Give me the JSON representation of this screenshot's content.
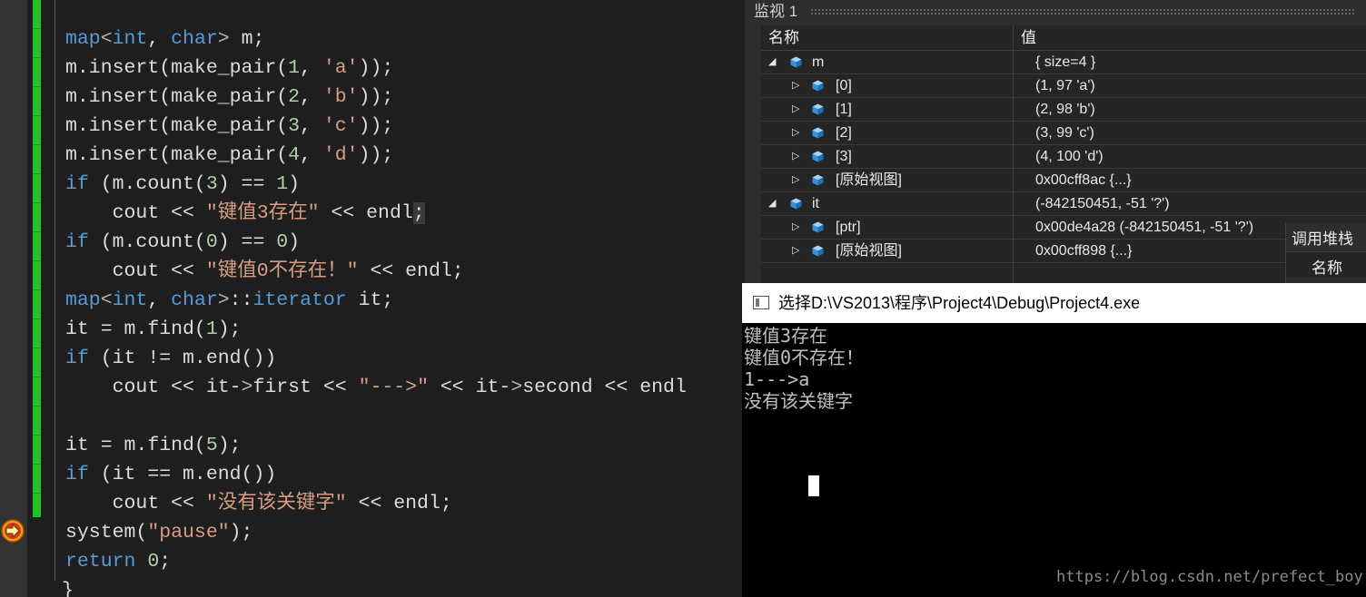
{
  "editor": {
    "lines": [
      "map<int, char> m;",
      "m.insert(make_pair(1, 'a'));",
      "m.insert(make_pair(2, 'b'));",
      "m.insert(make_pair(3, 'c'));",
      "m.insert(make_pair(4, 'd'));",
      "if (m.count(3) == 1)",
      "    cout << \"键值3存在\" << endl;",
      "if (m.count(0) == 0)",
      "    cout << \"键值0不存在！\" << endl;",
      "map<int, char>::iterator it;",
      "it = m.find(1);",
      "if (it != m.end())",
      "    cout << it->first << \"--->\" << it->second << endl",
      "",
      "it = m.find(5);",
      "if (it == m.end())",
      "    cout << \"没有该关键字\" << endl;",
      "system(\"pause\");",
      "return 0;",
      "}"
    ]
  },
  "watch": {
    "title": "监视 1",
    "col_name": "名称",
    "col_value": "值",
    "rows": [
      {
        "name": "m",
        "value": "{ size=4 }",
        "expanded": true
      },
      {
        "name": "[0]",
        "value": "(1, 97 'a')",
        "expanded": false
      },
      {
        "name": "[1]",
        "value": "(2, 98 'b')",
        "expanded": false
      },
      {
        "name": "[2]",
        "value": "(3, 99 'c')",
        "expanded": false
      },
      {
        "name": "[3]",
        "value": "(4, 100 'd')",
        "expanded": false
      },
      {
        "name": "[原始视图]",
        "value": "0x00cff8ac {...}",
        "expanded": false
      },
      {
        "name": "it",
        "value": "(-842150451, -51 '?')",
        "expanded": true
      },
      {
        "name": "[ptr]",
        "value": "0x00de4a28 (-842150451, -51 '?')",
        "expanded": false
      },
      {
        "name": "[原始视图]",
        "value": "0x00cff898 {...}",
        "expanded": false
      }
    ]
  },
  "callstack": {
    "title": "调用堆栈",
    "col_name": "名称"
  },
  "console": {
    "title": "选择D:\\VS2013\\程序\\Project4\\Debug\\Project4.exe",
    "output": [
      "键值3存在",
      "键值0不存在！",
      "1--->a",
      "没有该关键字"
    ]
  },
  "watermark": "https://blog.csdn.net/prefect_boy",
  "colors": {
    "editor_bg": "#1e1e1e",
    "keyword": "#569cd6",
    "string": "#d69d85",
    "number": "#b5cea8",
    "changed_bar": "#21c32a",
    "console_bg": "#000000"
  },
  "icons": {
    "breakpoint_arrow": "execution-arrow-icon",
    "variable": "cube-icon",
    "expanded": "triangle-down-icon",
    "collapsed": "triangle-right-icon",
    "console": "console-window-icon"
  }
}
